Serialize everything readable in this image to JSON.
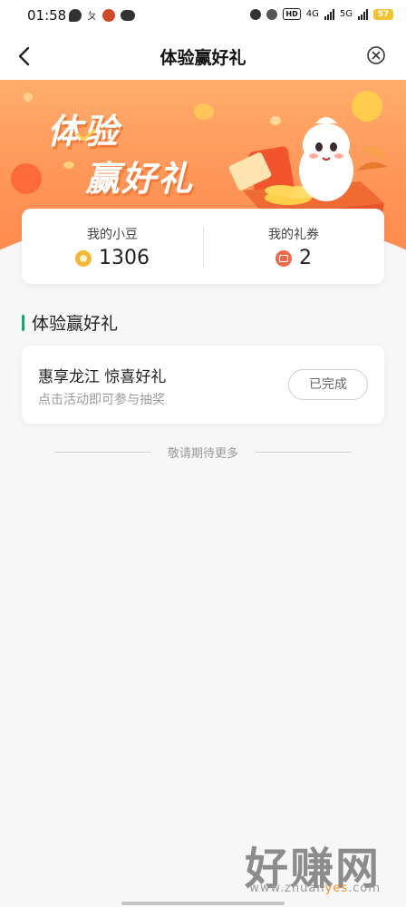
{
  "status_bar": {
    "time": "01:58",
    "notif_text": "ㄆ",
    "network_1": "4G",
    "network_2": "5G",
    "hd_label": "HD",
    "battery": "57"
  },
  "nav": {
    "title": "体验赢好礼"
  },
  "banner": {
    "line1": "体验",
    "line2": "赢好礼"
  },
  "stats": {
    "beans_label": "我的小豆",
    "beans_value": "1306",
    "coupons_label": "我的礼券",
    "coupons_value": "2"
  },
  "section": {
    "title": "体验赢好礼"
  },
  "activities": [
    {
      "title": "惠享龙江 惊喜好礼",
      "subtitle": "点击活动即可参与抽奖",
      "status": "已完成"
    }
  ],
  "footer_note": "敬请期待更多",
  "watermark": {
    "main": "好赚网",
    "url_prefix": "www.zhuan",
    "url_highlight": "yes",
    "url_suffix": ".com"
  },
  "colors": {
    "accent_green": "#1aa37b",
    "banner_orange": "#ff9559",
    "coin_yellow": "#f6b63a",
    "coupon_red": "#f0694c"
  }
}
